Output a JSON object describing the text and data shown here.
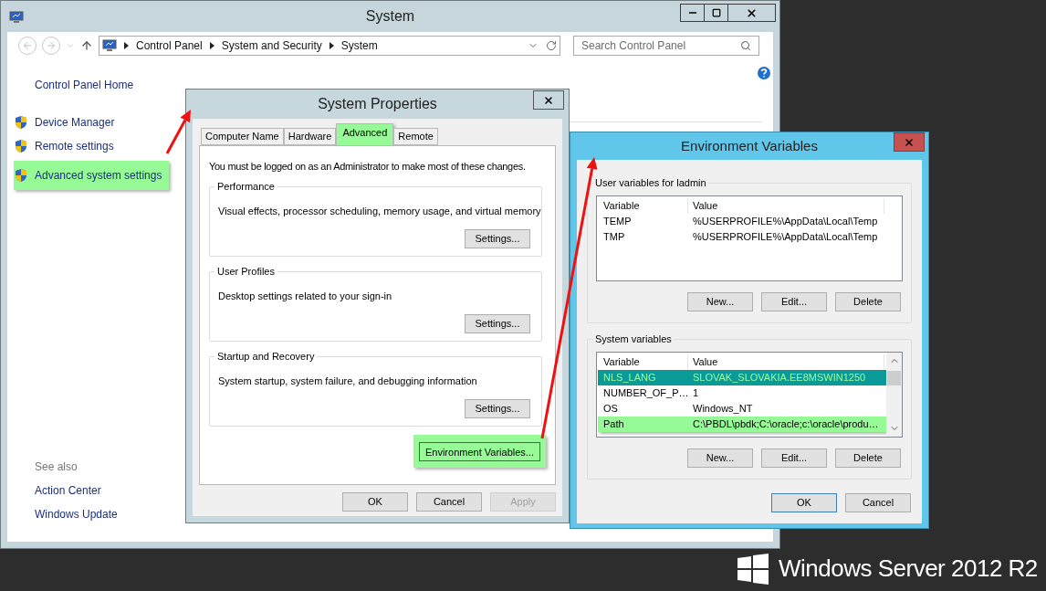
{
  "system_window": {
    "title": "System",
    "breadcrumb": [
      "Control Panel",
      "System and Security",
      "System"
    ],
    "search": {
      "placeholder": "Search Control Panel"
    },
    "sidebar": {
      "home": "Control Panel Home",
      "tasks": [
        {
          "label": "Device Manager",
          "highlighted": false
        },
        {
          "label": "Remote settings",
          "highlighted": false
        },
        {
          "label": "Advanced system settings",
          "highlighted": true
        }
      ],
      "see_also_heading": "See also",
      "see_also": [
        "Action Center",
        "Windows Update"
      ]
    }
  },
  "system_properties": {
    "title": "System Properties",
    "tabs": [
      {
        "label": "Computer Name",
        "selected": false,
        "highlighted": false
      },
      {
        "label": "Hardware",
        "selected": false,
        "highlighted": false
      },
      {
        "label": "Advanced",
        "selected": true,
        "highlighted": true
      },
      {
        "label": "Remote",
        "selected": false,
        "highlighted": false
      }
    ],
    "notice": "You must be logged on as an Administrator to make most of these changes.",
    "groups": [
      {
        "title": "Performance",
        "description": "Visual effects, processor scheduling, memory usage, and virtual memory",
        "button": "Settings..."
      },
      {
        "title": "User Profiles",
        "description": "Desktop settings related to your sign-in",
        "button": "Settings..."
      },
      {
        "title": "Startup and Recovery",
        "description": "System startup, system failure, and debugging information",
        "button": "Settings..."
      }
    ],
    "env_button": {
      "label": "Environment Variables...",
      "highlighted": true
    },
    "buttons": [
      {
        "label": "OK",
        "disabled": false
      },
      {
        "label": "Cancel",
        "disabled": false
      },
      {
        "label": "Apply",
        "disabled": true
      }
    ]
  },
  "environment_variables": {
    "title": "Environment Variables",
    "sections": [
      {
        "title": "User variables for ladmin",
        "columns": [
          "Variable",
          "Value"
        ],
        "scrollbar": false,
        "rows": [
          {
            "variable": "TEMP",
            "value": "%USERPROFILE%\\AppData\\Local\\Temp",
            "selected": false,
            "highlighted": false
          },
          {
            "variable": "TMP",
            "value": "%USERPROFILE%\\AppData\\Local\\Temp",
            "selected": false,
            "highlighted": false
          }
        ],
        "buttons": [
          "New...",
          "Edit...",
          "Delete"
        ]
      },
      {
        "title": "System variables",
        "columns": [
          "Variable",
          "Value"
        ],
        "scrollbar": true,
        "rows": [
          {
            "variable": "NLS_LANG",
            "value": "SLOVAK_SLOVAKIA.EE8MSWIN1250",
            "selected": true,
            "highlighted": true
          },
          {
            "variable": "NUMBER_OF_P…",
            "value": "1",
            "selected": false,
            "highlighted": false
          },
          {
            "variable": "OS",
            "value": "Windows_NT",
            "selected": false,
            "highlighted": false
          },
          {
            "variable": "Path",
            "value": "C:\\PBDL\\pbdk;C:\\oracle;c:\\oracle\\produ…",
            "selected": false,
            "highlighted": true
          }
        ],
        "buttons": [
          "New...",
          "Edit...",
          "Delete"
        ]
      }
    ],
    "buttons": [
      {
        "label": "OK",
        "default": true
      },
      {
        "label": "Cancel",
        "default": false
      }
    ]
  },
  "branding": "Windows Server 2012 R2"
}
